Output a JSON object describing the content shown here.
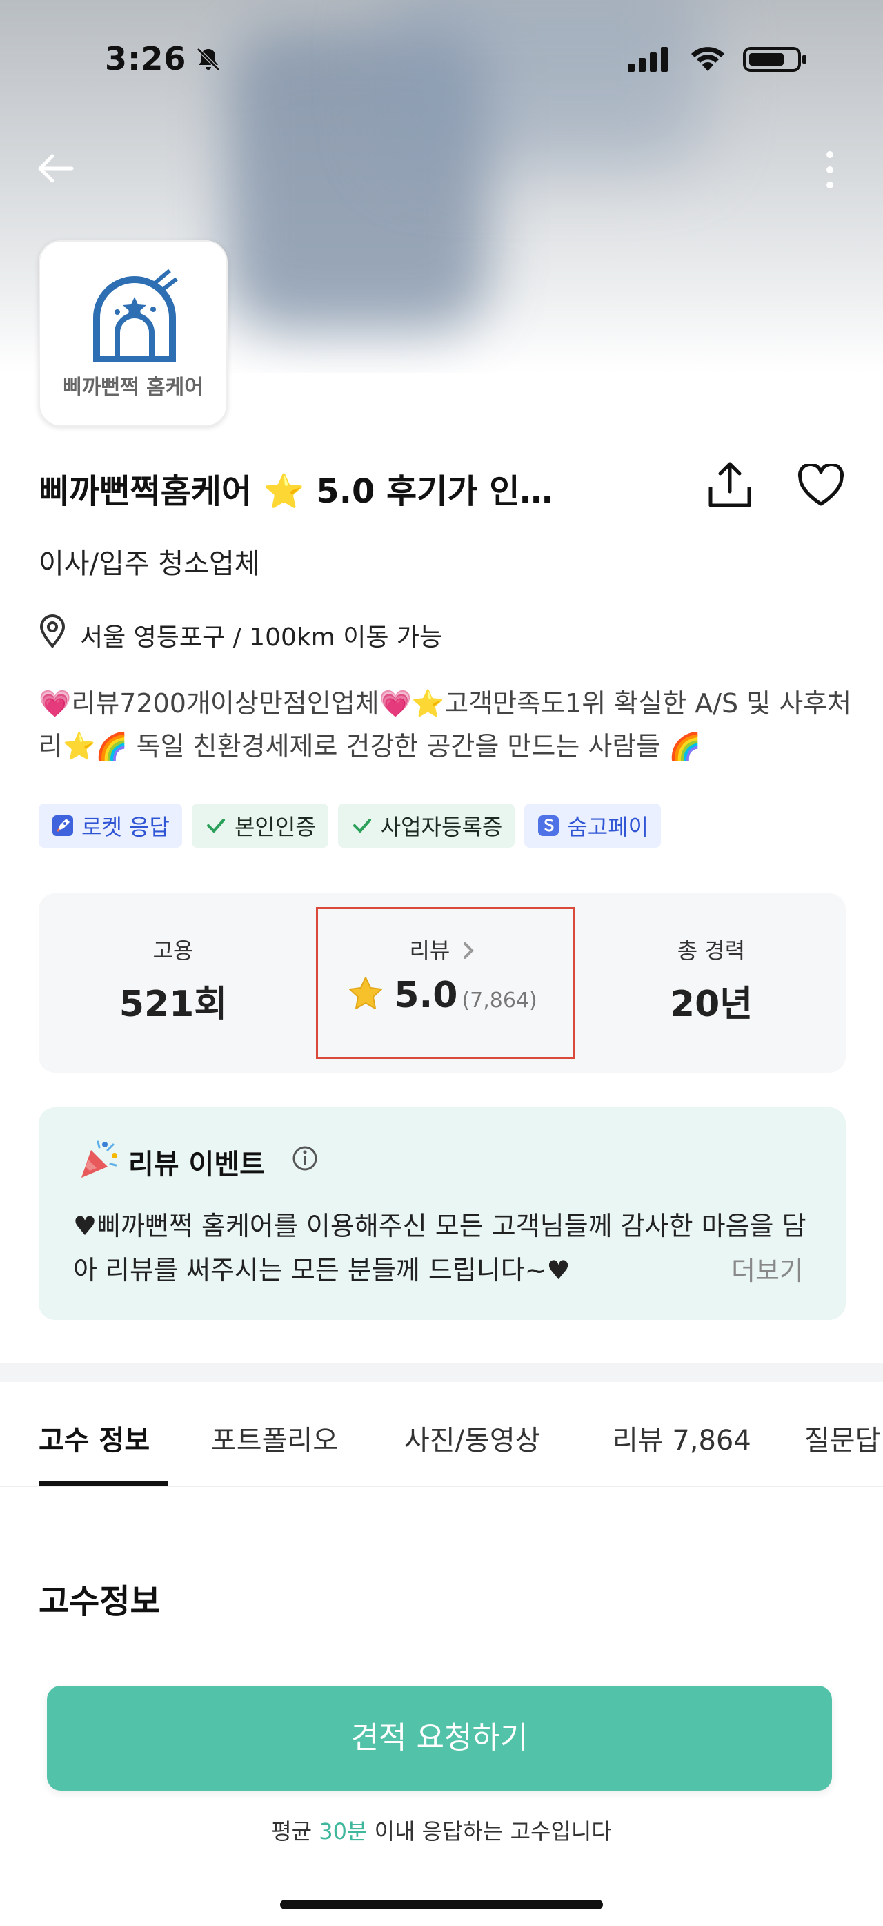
{
  "status_bar": {
    "time": "3:26"
  },
  "header": {
    "logo_text": "삐까뻔쩍 홈케어"
  },
  "profile": {
    "title": "삐까뻔쩍홈케어 ⭐ 5.0 후기가 인…",
    "category": "이사/입주 청소업체",
    "location": "서울 영등포구 / 100km 이동 가능",
    "intro": "💗리뷰7200개이상만점인업체💗⭐고객만족도1위 확실한 A/S 및 사후처리⭐🌈 독일 친환경세제로 건강한 공간을 만드는 사람들 🌈"
  },
  "badges": [
    {
      "label": "로켓 응답",
      "style": "blue",
      "icon": "rocket-icon"
    },
    {
      "label": "본인인증",
      "style": "green",
      "icon": "check-icon"
    },
    {
      "label": "사업자등록증",
      "style": "green",
      "icon": "check-icon"
    },
    {
      "label": "숨고페이",
      "style": "blue",
      "icon": "pay-icon"
    }
  ],
  "stats": {
    "hire_label": "고용",
    "hire_value": "521회",
    "review_label": "리뷰",
    "review_rating": "5.0",
    "review_count": "(7,864)",
    "career_label": "총 경력",
    "career_value": "20년"
  },
  "event": {
    "title": "리뷰 이벤트",
    "body": "♥삐까뻔쩍 홈케어를 이용해주신 모든 고객님들께 감사한 마음을 담아 리뷰를 써주시는 모든 분들께 드립니다~♥",
    "more": "더보기"
  },
  "tabs": [
    {
      "label": "고수 정보",
      "active": true
    },
    {
      "label": "포트폴리오",
      "active": false
    },
    {
      "label": "사진/동영상",
      "active": false
    },
    {
      "label": "리뷰 7,864",
      "active": false
    },
    {
      "label": "질문답",
      "active": false
    }
  ],
  "section": {
    "title": "고수정보"
  },
  "cta": {
    "button": "견적 요청하기",
    "note_prefix": "평균 ",
    "note_accent": "30분",
    "note_suffix": " 이내 응답하는 고수입니다"
  },
  "colors": {
    "accent": "#52c2a8",
    "highlight_border": "#d94a3a",
    "event_bg": "#e9f6f3"
  }
}
